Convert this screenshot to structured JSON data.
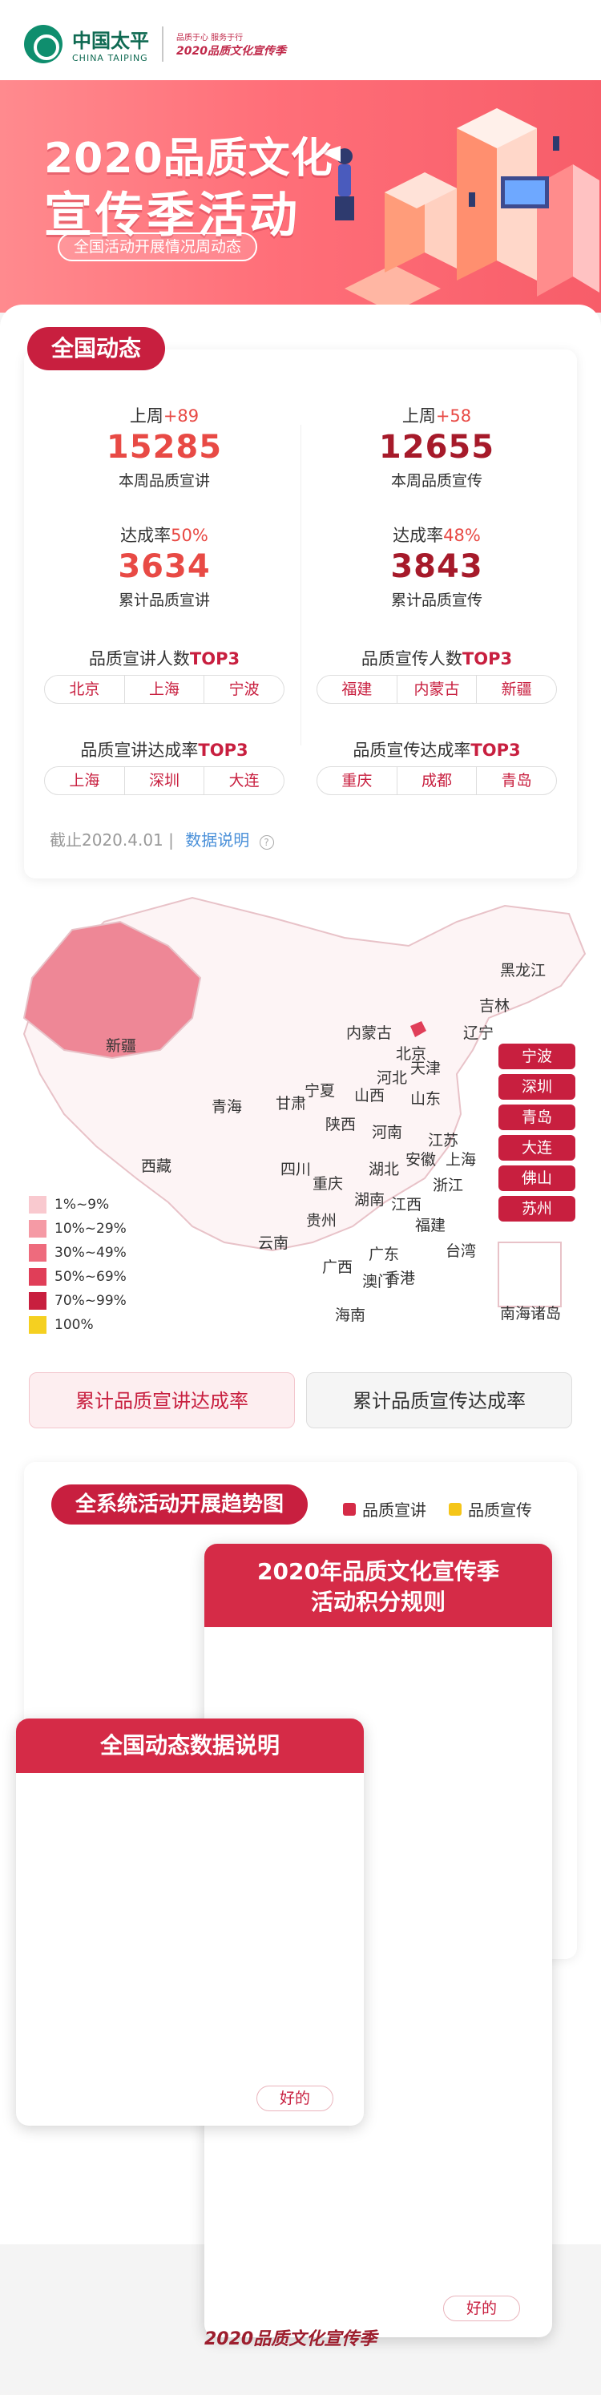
{
  "header": {
    "brand_cn": "中国太平",
    "brand_en": "CHINA TAIPING",
    "campaign_small": "品质于心 服务于行",
    "campaign_big": "2020品质文化宣传季"
  },
  "banner": {
    "title_line1": "2020品质文化",
    "title_line2": "宣传季活动",
    "subtitle": "全国活动开展情况周动态"
  },
  "national": {
    "tag": "全国动态",
    "left": {
      "week_label": "上周",
      "week_delta": "+89",
      "week_value": "15285",
      "week_caption": "本周品质宣讲",
      "rate_label": "达成率",
      "rate_value": "50%",
      "total_value": "3634",
      "total_caption": "累计品质宣讲",
      "top3_people_title": "品质宣讲人数",
      "top3_people_cities": [
        "北京",
        "上海",
        "宁波"
      ],
      "top3_rate_title": "品质宣讲达成率",
      "top3_rate_cities": [
        "上海",
        "深圳",
        "大连"
      ]
    },
    "right": {
      "week_label": "上周",
      "week_delta": "+58",
      "week_value": "12655",
      "week_caption": "本周品质宣传",
      "rate_label": "达成率",
      "rate_value": "48%",
      "total_value": "3843",
      "total_caption": "累计品质宣传",
      "top3_people_title": "品质宣传人数",
      "top3_people_cities": [
        "福建",
        "内蒙古",
        "新疆"
      ],
      "top3_rate_title": "品质宣传达成率",
      "top3_rate_cities": [
        "重庆",
        "成都",
        "青岛"
      ]
    },
    "top3_suffix": "TOP3",
    "as_of": "截止2020.4.01",
    "data_note_link": "数据说明"
  },
  "map": {
    "provinces": [
      "黑龙江",
      "吉林",
      "辽宁",
      "内蒙古",
      "北京",
      "天津",
      "新疆",
      "宁夏",
      "河北",
      "山西",
      "山东",
      "青海",
      "甘肃",
      "陕西",
      "河南",
      "江苏",
      "西藏",
      "四川",
      "湖北",
      "安徽",
      "上海",
      "重庆",
      "浙江",
      "湖南",
      "江西",
      "贵州",
      "福建",
      "云南",
      "广东",
      "台湾",
      "广西",
      "香港",
      "澳门",
      "海南",
      "南海诸岛"
    ],
    "city_list": [
      "宁波",
      "深圳",
      "青岛",
      "大连",
      "佛山",
      "苏州"
    ],
    "legend": [
      {
        "label": "1%~9%",
        "color": "#f9c9cf"
      },
      {
        "label": "10%~29%",
        "color": "#f59aa5"
      },
      {
        "label": "30%~49%",
        "color": "#ee6b7d"
      },
      {
        "label": "50%~69%",
        "color": "#e03e58"
      },
      {
        "label": "70%~99%",
        "color": "#c81f3f"
      },
      {
        "label": "100%",
        "color": "#f5d020"
      }
    ],
    "tab_active": "累计品质宣讲达成率",
    "tab_inactive": "累计品质宣传达成率"
  },
  "trend": {
    "tag": "全系统活动开展趋势图",
    "legend_a": "品质宣讲",
    "legend_a_color": "#d52b47",
    "legend_b": "品质宣传",
    "legend_b_color": "#f5c518"
  },
  "modal_rules": {
    "title_line1": "2020年品质文化宣传季",
    "title_line2": "活动积分规则",
    "ok": "好的"
  },
  "modal_data": {
    "title": "全国动态数据说明",
    "ok": "好的"
  },
  "footer": {
    "logo": "2020品质文化宣传季"
  },
  "colors": {
    "primary": "#c81f3f",
    "accent_red": "#e84a45",
    "banner_pink": "#ff6f79"
  }
}
